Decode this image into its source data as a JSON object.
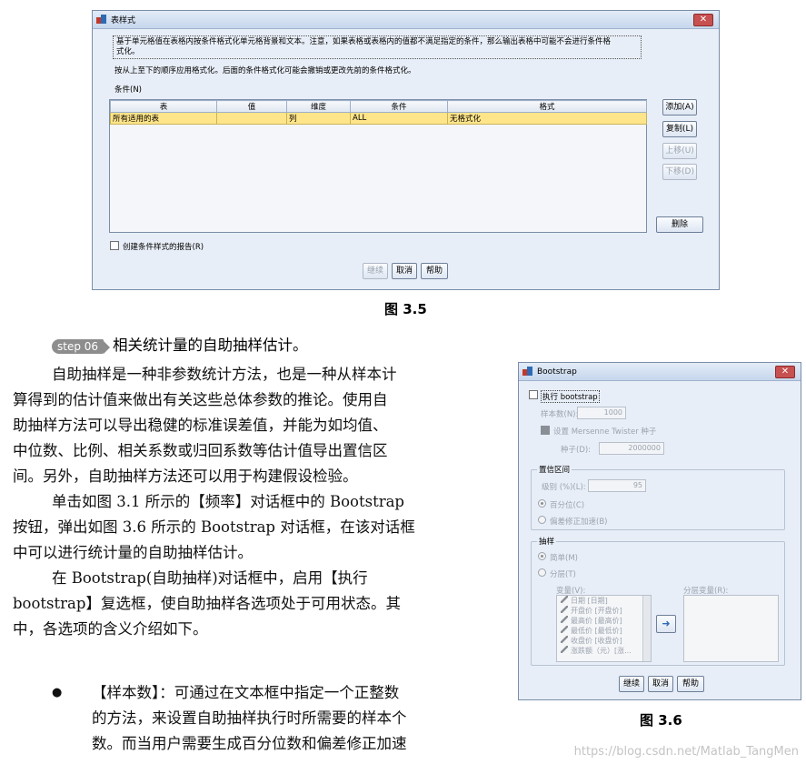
{
  "fig35": {
    "title": "表样式",
    "desc_line1": "基于单元格值在表格内按条件格式化单元格背景和文本。注意，如果表格或表格内的值都不满足指定的条件，那么输出表格中可能不会进行条件格",
    "desc_line2": "式化。",
    "order_note": "按从上至下的顺序应用格式化。后面的条件格式化可能会撤销或更改先前的条件格式化。",
    "conditions_label": "条件(N)",
    "columns": [
      "表",
      "值",
      "维度",
      "条件",
      "格式"
    ],
    "row": [
      "所有适用的表",
      "",
      "列",
      "ALL",
      "无格式化"
    ],
    "add_btn": "添加(A)",
    "copy_btn": "复制(L)",
    "up_btn": "上移(U)",
    "down_btn": "下移(D)",
    "delete_btn": "删除",
    "report_checkbox": "创建条件样式的报告(R)",
    "continue_btn": "继续",
    "cancel_btn": "取消",
    "help_btn": "帮助",
    "caption": "图 3.5"
  },
  "body": {
    "step_badge": "step 06",
    "step_title": "相关统计量的自助抽样估计。",
    "lines": [
      "自助抽样是一种非参数统计方法，也是一种从样本计",
      "算得到的估计值来做出有关这些总体参数的推论。使用自",
      "助抽样方法可以导出稳健的标准误差值，并能为如均值、",
      "中位数、比例、相关系数或归回系数等估计值导出置信区",
      "间。另外，自助抽样方法还可以用于构建假设检验。",
      "单击如图 3.1 所示的【频率】对话框中的 Bootstrap",
      "按钮，弹出如图 3.6 所示的 Bootstrap 对话框，在该对话框",
      "中可以进行统计量的自助抽样估计。",
      "在 Bootstrap(自助抽样)对话框中，启用【执行",
      "bootstrap】复选框，使自助抽样各选项处于可用状态。其",
      "中，各选项的含义介绍如下。"
    ],
    "bullet_lines": [
      "【样本数】：可通过在文本框中指定一个正整数",
      "的方法，来设置自助抽样执行时所需要的样本个",
      "数。而当用户需要生成百分位数和偏差修正加速"
    ],
    "bullet": "●"
  },
  "fig36": {
    "title": "Bootstrap",
    "perform_checkbox": "执行 bootstrap",
    "samples_label": "样本数(N):",
    "samples_value": "1000",
    "mersenne_label": "设置 Mersenne Twister 种子",
    "seed_label": "种子(D):",
    "seed_value": "2000000",
    "ci_group": "置信区间",
    "level_label": "级别 (%)(L):",
    "level_value": "95",
    "percentile": "百分位(C)",
    "bca": "偏差修正加速(B)",
    "sampling_group": "抽样",
    "simple": "简单(M)",
    "stratified": "分层(T)",
    "variables_label": "变量(V):",
    "strata_label": "分层变量(R):",
    "variables": [
      "日期 [日期]",
      "开盘价 [开盘价]",
      "最高价 [最高价]",
      "最低价 [最低价]",
      "收盘价 [收盘价]",
      "涨跌额（元）[涨..."
    ],
    "continue_btn": "继续",
    "cancel_btn": "取消",
    "help_btn": "帮助",
    "caption": "图 3.6"
  },
  "watermark": "https://blog.csdn.net/Matlab_TangMen",
  "colors": {
    "row_highlight": "#ffe58a",
    "dialog_bg": "#e8eef7",
    "close_red": "#c75050"
  }
}
